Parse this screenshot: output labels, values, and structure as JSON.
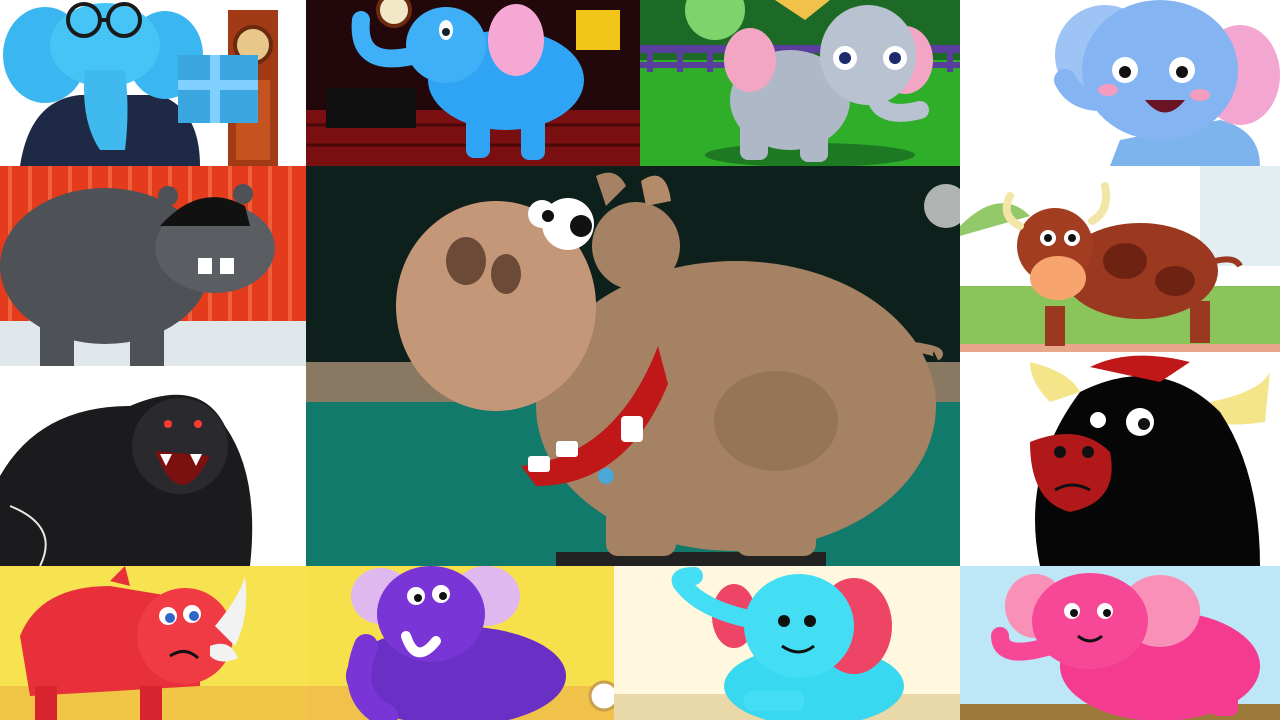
{
  "collage": {
    "layout": "grid-with-center-feature",
    "tiles": [
      {
        "subject": "blue-elephant-with-glasses-and-gift",
        "background": "#ffffff"
      },
      {
        "subject": "blue-elephant-in-dark-room",
        "background": "#2a0a0a"
      },
      {
        "subject": "grey-elephant-in-garden",
        "background": "#4fcf3a"
      },
      {
        "subject": "smiling-blue-elephant-face",
        "background": "#ffffff"
      },
      {
        "subject": "grey-hippo-on-red-stripes",
        "background": "#e4321a"
      },
      {
        "subject": "brown-hippo-feature",
        "background": "#0c1f1a"
      },
      {
        "subject": "brown-spotted-bull",
        "background": "#cfe9b4"
      },
      {
        "subject": "roaring-gorilla",
        "background": "#ffffff"
      },
      {
        "subject": "black-bull-with-horns",
        "background": "#ffffff"
      },
      {
        "subject": "red-rhino",
        "background": "#f4e24a"
      },
      {
        "subject": "purple-elephant",
        "background": "#f6df4a"
      },
      {
        "subject": "cyan-elephant",
        "background": "#fff3d4"
      },
      {
        "subject": "pink-elephant",
        "background": "#bde7f7"
      }
    ]
  }
}
